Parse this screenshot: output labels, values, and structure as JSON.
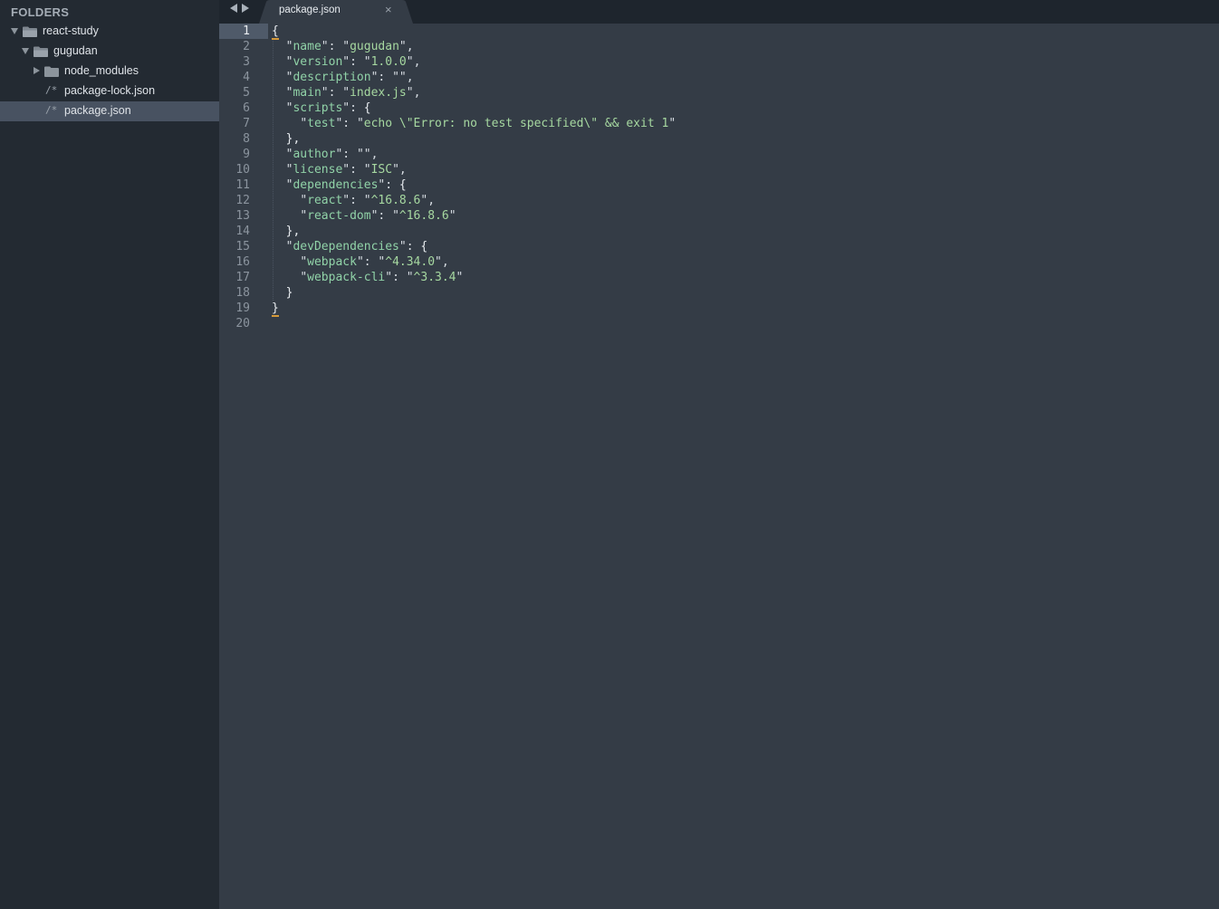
{
  "sidebar": {
    "header": "FOLDERS",
    "items": [
      {
        "label": "react-study",
        "kind": "folder",
        "expanded": true,
        "level": 0
      },
      {
        "label": "gugudan",
        "kind": "folder",
        "expanded": true,
        "level": 1
      },
      {
        "label": "node_modules",
        "kind": "folder",
        "expanded": false,
        "level": 2
      },
      {
        "label": "package-lock.json",
        "kind": "file",
        "glyph": "/*",
        "level": 2
      },
      {
        "label": "package.json",
        "kind": "file",
        "glyph": "/*",
        "level": 2,
        "selected": true
      }
    ]
  },
  "tabs": [
    {
      "label": "package.json",
      "active": true,
      "close": "×"
    }
  ],
  "editor": {
    "active_line": 1,
    "line_numbers": [
      "1",
      "2",
      "3",
      "4",
      "5",
      "6",
      "7",
      "8",
      "9",
      "10",
      "11",
      "12",
      "13",
      "14",
      "15",
      "16",
      "17",
      "18",
      "19",
      "20"
    ],
    "lines": [
      "{",
      "  \"name\": \"gugudan\",",
      "  \"version\": \"1.0.0\",",
      "  \"description\": \"\",",
      "  \"main\": \"index.js\",",
      "  \"scripts\": {",
      "    \"test\": \"echo \\\"Error: no test specified\\\" && exit 1\"",
      "  },",
      "  \"author\": \"\",",
      "  \"license\": \"ISC\",",
      "  \"dependencies\": {",
      "    \"react\": \"^16.8.6\",",
      "    \"react-dom\": \"^16.8.6\"",
      "  },",
      "  \"devDependencies\": {",
      "    \"webpack\": \"^4.34.0\",",
      "    \"webpack-cli\": \"^3.3.4\"",
      "  }",
      "}",
      ""
    ]
  },
  "colors": {
    "sidebar_bg": "#232a32",
    "editor_bg": "#343c46",
    "tabbar_bg": "#1e252d",
    "key_color": "#91d3a8",
    "bracket_match": "#d69a3a",
    "selection_bg": "#485261"
  }
}
